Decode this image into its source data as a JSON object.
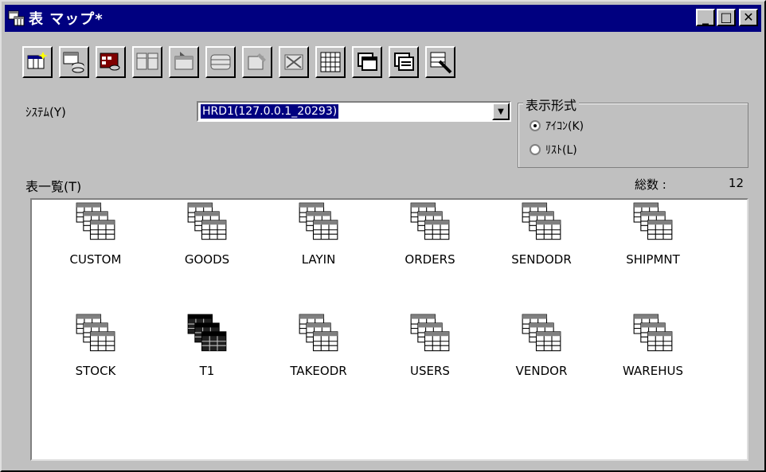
{
  "window": {
    "title": "表 マップ*",
    "buttons": {
      "minimize": "_",
      "maximize": "□",
      "close": "✕"
    }
  },
  "toolbar": {
    "tools": [
      {
        "icon": "new-table-icon",
        "enabled": true
      },
      {
        "icon": "table-database-icon",
        "enabled": true
      },
      {
        "icon": "database-grid-icon",
        "enabled": true
      },
      {
        "icon": "table-export-icon",
        "enabled": false
      },
      {
        "icon": "table-import-icon",
        "enabled": false
      },
      {
        "icon": "table-structure-icon",
        "enabled": false
      },
      {
        "icon": "table-edit-icon",
        "enabled": false
      },
      {
        "icon": "table-delete-icon",
        "enabled": false
      },
      {
        "icon": "grid-view-icon",
        "enabled": true
      },
      {
        "icon": "copy-icon",
        "enabled": true
      },
      {
        "icon": "paste-icon",
        "enabled": true
      },
      {
        "icon": "tool-settings-icon",
        "enabled": true
      }
    ]
  },
  "system": {
    "label": "ｼｽﾃﾑ(Y)",
    "value": "HRD1(127.0.0.1_20293)"
  },
  "display_format": {
    "label": "表示形式",
    "options": [
      {
        "label": "ｱｲｺﾝ(K)",
        "selected": true
      },
      {
        "label": "ﾘｽﾄ(L)",
        "selected": false
      }
    ]
  },
  "table_list": {
    "label": "表一覧(T)",
    "total_label": "総数 :",
    "total_value": "12",
    "items": [
      {
        "name": "CUSTOM",
        "icon": "table-icon"
      },
      {
        "name": "GOODS",
        "icon": "table-icon"
      },
      {
        "name": "LAYIN",
        "icon": "table-icon"
      },
      {
        "name": "ORDERS",
        "icon": "table-icon"
      },
      {
        "name": "SENDODR",
        "icon": "table-icon"
      },
      {
        "name": "SHIPMNT",
        "icon": "table-icon"
      },
      {
        "name": "STOCK",
        "icon": "table-icon"
      },
      {
        "name": "T1",
        "icon": "table-dark-icon"
      },
      {
        "name": "TAKEODR",
        "icon": "table-icon"
      },
      {
        "name": "USERS",
        "icon": "table-icon"
      },
      {
        "name": "VENDOR",
        "icon": "table-icon"
      },
      {
        "name": "WAREHUS",
        "icon": "table-icon"
      }
    ]
  }
}
